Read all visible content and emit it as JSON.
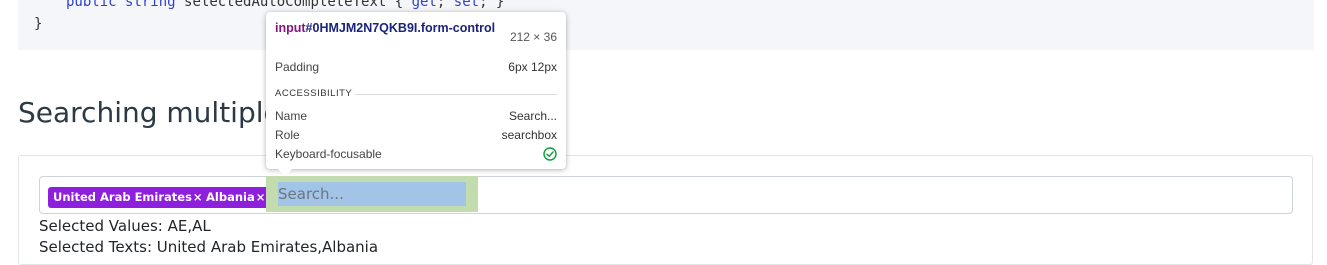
{
  "code": {
    "line1_keywords": [
      "public",
      "string"
    ],
    "line1_name": "selectedAutoCompleteText",
    "line1_get": "get",
    "line1_set": "set",
    "line2": "}"
  },
  "heading": "Searching multiple",
  "tags": [
    {
      "label": "United Arab Emirates",
      "remove": "×"
    },
    {
      "label": "Albania",
      "remove": "×"
    }
  ],
  "search": {
    "placeholder": "Search..."
  },
  "selected_values": "Selected Values: AE,AL",
  "selected_texts": "Selected Texts: United Arab Emirates,Albania",
  "inspector": {
    "tag_name": "input",
    "selector": "#0HMJM2N7QKB9I.form-control",
    "size": "212 × 36",
    "padding_label": "Padding",
    "padding_value": "6px 12px",
    "section": "ACCESSIBILITY",
    "name_label": "Name",
    "name_value": "Search...",
    "role_label": "Role",
    "role_value": "searchbox",
    "focusable_label": "Keyboard-focusable",
    "focusable_icon": "check-circle-icon"
  },
  "colors": {
    "tag_bg": "#8e1fdd",
    "padding_highlight": "#c3dcaf",
    "content_highlight": "#a2c4e6",
    "check_green": "#0a9d38"
  }
}
